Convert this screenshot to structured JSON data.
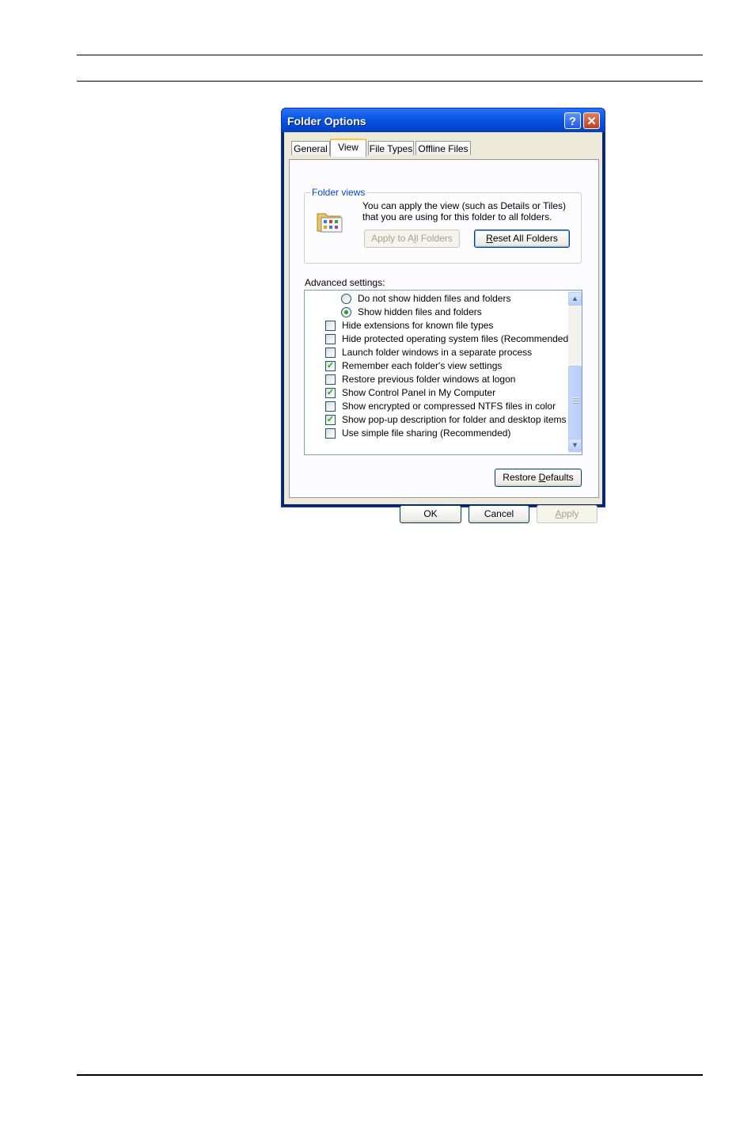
{
  "window": {
    "title": "Folder Options",
    "help_glyph": "?",
    "close_glyph": "✕"
  },
  "tabs": [
    {
      "label": "General",
      "active": false
    },
    {
      "label": "View",
      "active": true
    },
    {
      "label": "File Types",
      "active": false
    },
    {
      "label": "Offline Files",
      "active": false
    }
  ],
  "folder_views": {
    "legend": "Folder views",
    "icon": "folder-views-icon",
    "description": "You can apply the view (such as Details or Tiles) that you are using for this folder to all folders.",
    "apply_all_pre": "Apply to A",
    "apply_all_u": "l",
    "apply_all_post": "l Folders",
    "apply_all_enabled": false,
    "reset_all_u": "R",
    "reset_all_post": "eset All Folders"
  },
  "advanced": {
    "label": "Advanced settings:",
    "items": [
      {
        "type": "radio",
        "label": "Do not show hidden files and folders",
        "checked": false
      },
      {
        "type": "radio",
        "label": "Show hidden files and folders",
        "checked": true
      },
      {
        "type": "checkbox",
        "label": "Hide extensions for known file types",
        "checked": false
      },
      {
        "type": "checkbox",
        "label": "Hide protected operating system files (Recommended)",
        "checked": false
      },
      {
        "type": "checkbox",
        "label": "Launch folder windows in a separate process",
        "checked": false
      },
      {
        "type": "checkbox",
        "label": "Remember each folder's view settings",
        "checked": true
      },
      {
        "type": "checkbox",
        "label": "Restore previous folder windows at logon",
        "checked": false
      },
      {
        "type": "checkbox",
        "label": "Show Control Panel in My Computer",
        "checked": true
      },
      {
        "type": "checkbox",
        "label": "Show encrypted or compressed NTFS files in color",
        "checked": false
      },
      {
        "type": "checkbox",
        "label": "Show pop-up description for folder and desktop items",
        "checked": true
      },
      {
        "type": "checkbox",
        "label": "Use simple file sharing (Recommended)",
        "checked": false
      }
    ],
    "restore_pre": "Restore ",
    "restore_u": "D",
    "restore_post": "efaults"
  },
  "footer": {
    "ok": "OK",
    "cancel": "Cancel",
    "apply_u": "A",
    "apply_post": "pply",
    "apply_enabled": false
  },
  "colors": {
    "title_bar": "#0a5ae8",
    "dialog_bg": "#ece9d8",
    "check_green": "#21a121",
    "legend_blue": "#0046d5"
  }
}
